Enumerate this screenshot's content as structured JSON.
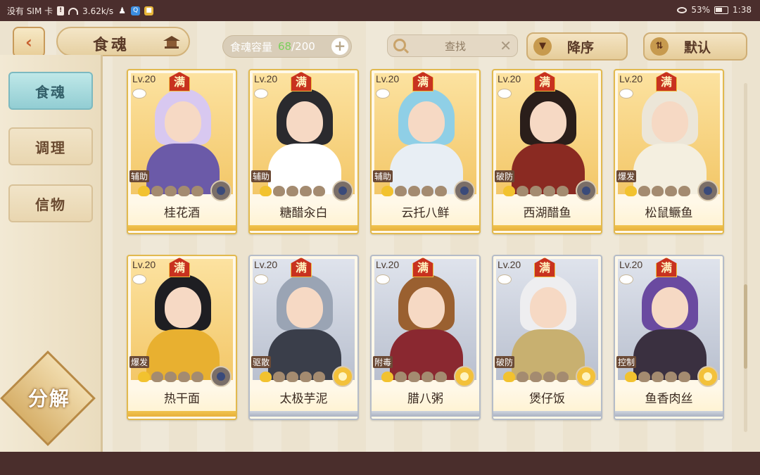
{
  "status_bar": {
    "carrier": "没有 SIM 卡",
    "speed": "3.62k/s",
    "battery": "53%",
    "time": "1:38"
  },
  "header": {
    "back_icon": "back-arrow-icon",
    "title": "食魂",
    "capacity_label": "食魂容量",
    "capacity_count": "68",
    "capacity_max": "/200",
    "search_placeholder": "查找",
    "sort_desc_label": "降序",
    "sort_default_label": "默认"
  },
  "sidebar": {
    "items": [
      {
        "label": "食魂",
        "active": true
      },
      {
        "label": "调理",
        "active": false
      },
      {
        "label": "信物",
        "active": false
      }
    ],
    "decompose_label": "分解"
  },
  "cards": [
    {
      "name": "桂花酒",
      "level": "Lv.20",
      "max_badge": "满",
      "role": "辅助",
      "stars": 1,
      "element": "dark",
      "frame": "gold",
      "hair": "#d8c8f0",
      "outfit": "#6b5aa8"
    },
    {
      "name": "糖醋汆白",
      "level": "Lv.20",
      "max_badge": "满",
      "role": "辅助",
      "stars": 1,
      "element": "dark",
      "frame": "gold",
      "hair": "#2a2a2e",
      "outfit": "#ffffff"
    },
    {
      "name": "云托八鲜",
      "level": "Lv.20",
      "max_badge": "满",
      "role": "辅助",
      "stars": 1,
      "element": "dark",
      "frame": "gold",
      "hair": "#8fcfe6",
      "outfit": "#e8eef4"
    },
    {
      "name": "西湖醋鱼",
      "level": "Lv.20",
      "max_badge": "满",
      "role": "破防",
      "stars": 1,
      "element": "dark",
      "frame": "gold",
      "hair": "#2a1e1a",
      "outfit": "#8a2a22"
    },
    {
      "name": "松鼠鳜鱼",
      "level": "Lv.20",
      "max_badge": "满",
      "role": "爆发",
      "stars": 1,
      "element": "dark",
      "frame": "gold",
      "hair": "#ece6d8",
      "outfit": "#f4efe0"
    },
    {
      "name": "热干面",
      "level": "Lv.20",
      "max_badge": "满",
      "role": "爆发",
      "stars": 1,
      "element": "dark",
      "frame": "gold",
      "hair": "#1e1e22",
      "outfit": "#e8b030"
    },
    {
      "name": "太极芋泥",
      "level": "Lv.20",
      "max_badge": "满",
      "role": "驱散",
      "stars": 1,
      "element": "gold",
      "frame": "silver",
      "hair": "#9aa4b4",
      "outfit": "#3a3e4a"
    },
    {
      "name": "腊八粥",
      "level": "Lv.20",
      "max_badge": "满",
      "role": "附毒",
      "stars": 1,
      "element": "gold",
      "frame": "silver",
      "hair": "#9a6030",
      "outfit": "#8a2830"
    },
    {
      "name": "煲仔饭",
      "level": "Lv.20",
      "max_badge": "满",
      "role": "破防",
      "stars": 1,
      "element": "gold",
      "frame": "silver",
      "hair": "#eeeef0",
      "outfit": "#c8b070"
    },
    {
      "name": "鱼香肉丝",
      "level": "Lv.20",
      "max_badge": "满",
      "role": "控制",
      "stars": 1,
      "element": "gold",
      "frame": "silver",
      "hair": "#6a4aa0",
      "outfit": "#3a3040"
    }
  ],
  "colors": {
    "accent_gold": "#e2b94e",
    "active_tab": "#92cdd3",
    "capacity_count": "#7ccf5d"
  }
}
